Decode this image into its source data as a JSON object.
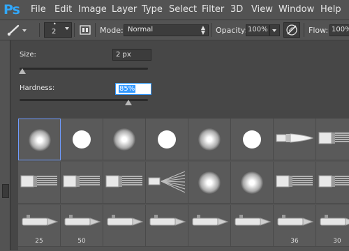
{
  "app": {
    "logo": "Ps"
  },
  "menu": [
    "File",
    "Edit",
    "Image",
    "Layer",
    "Type",
    "Select",
    "Filter",
    "3D",
    "View",
    "Window",
    "Help"
  ],
  "options": {
    "brush_size": "2",
    "mode_label": "Mode:",
    "mode_value": "Normal",
    "opacity_label": "Opacity:",
    "opacity_value": "100%",
    "flow_label": "Flow:",
    "flow_value": "100%"
  },
  "brush_picker": {
    "size_label": "Size:",
    "size_value": "2 px",
    "size_level": 0.02,
    "hardness_label": "Hardness:",
    "hardness_value": "85%",
    "hardness_level": 0.85
  },
  "presets": [
    {
      "type": "soft-round",
      "selected": true,
      "label": ""
    },
    {
      "type": "hard-round",
      "label": ""
    },
    {
      "type": "soft-round",
      "label": ""
    },
    {
      "type": "hard-round",
      "label": ""
    },
    {
      "type": "soft-round",
      "label": ""
    },
    {
      "type": "hard-round",
      "label": ""
    },
    {
      "type": "round-brush",
      "label": ""
    },
    {
      "type": "flat-brush",
      "label": ""
    },
    {
      "type": "flat-brush",
      "label": ""
    },
    {
      "type": "flat-brush",
      "label": ""
    },
    {
      "type": "flat-brush",
      "label": ""
    },
    {
      "type": "fan-brush",
      "label": ""
    },
    {
      "type": "soft-round",
      "label": ""
    },
    {
      "type": "soft-round",
      "label": ""
    },
    {
      "type": "flat-brush",
      "label": ""
    },
    {
      "type": "flat-brush",
      "label": ""
    },
    {
      "type": "pencil",
      "label": "25"
    },
    {
      "type": "pencil",
      "label": "50"
    },
    {
      "type": "pencil",
      "label": ""
    },
    {
      "type": "pencil",
      "label": ""
    },
    {
      "type": "pencil",
      "label": ""
    },
    {
      "type": "pencil",
      "label": ""
    },
    {
      "type": "pencil",
      "label": "36"
    },
    {
      "type": "pencil",
      "label": "30"
    }
  ]
}
